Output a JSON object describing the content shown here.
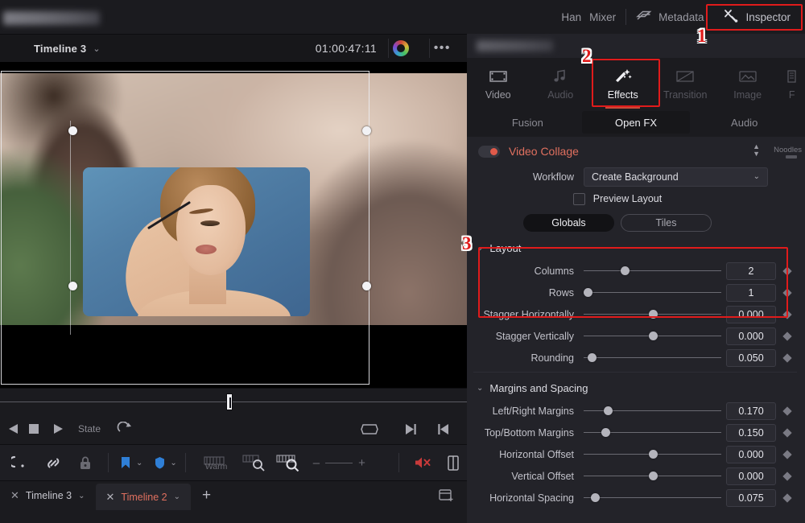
{
  "top_bar": {
    "items": [
      {
        "label": "Han",
        "icon": "",
        "dim": true
      },
      {
        "label": "Mixer",
        "icon": "mixer-icon",
        "dim": true
      },
      {
        "label": "Metadata",
        "icon": "metadata-tag-icon",
        "dim": true
      },
      {
        "label": "Inspector",
        "icon": "inspector-wrench-icon",
        "dim": false
      }
    ]
  },
  "timeline_header": {
    "name": "Timeline 3",
    "caret": "⌄",
    "timecode": "01:00:47:11",
    "dots": "•••"
  },
  "transport": {
    "state_label": "State",
    "buttons": [
      "reverse-play",
      "stop",
      "play",
      "loop",
      "fit-screen",
      "next-frame",
      "prev-frame"
    ]
  },
  "edit_toolbar": {
    "warm_label": "Warm",
    "zoom_minus": "–",
    "zoom_plus": "+"
  },
  "timeline_tabs": {
    "tabs": [
      {
        "label": "Timeline 3",
        "active": false
      },
      {
        "label": "Timeline 2",
        "active": true
      }
    ],
    "add_label": "+"
  },
  "inspector": {
    "tabs": [
      {
        "label": "Video",
        "icon": "video-clip-icon",
        "state": "normal"
      },
      {
        "label": "Audio",
        "icon": "audio-note-icon",
        "state": "disabled"
      },
      {
        "label": "Effects",
        "icon": "magic-wand-icon",
        "state": "active"
      },
      {
        "label": "Transition",
        "icon": "transition-icon",
        "state": "disabled"
      },
      {
        "label": "Image",
        "icon": "image-icon",
        "state": "disabled"
      },
      {
        "label": "F",
        "icon": "file-icon",
        "state": "disabled"
      }
    ],
    "segments": [
      {
        "label": "Fusion",
        "active": false
      },
      {
        "label": "Open FX",
        "active": true
      },
      {
        "label": "Audio",
        "active": false
      }
    ],
    "effect": {
      "title": "Video Collage",
      "enabled": true,
      "noodles_label": "Noodles",
      "workflow_label": "Workflow",
      "workflow_value": "Create Background",
      "preview_layout_label": "Preview Layout",
      "preview_layout_checked": false,
      "mode_pills": [
        {
          "label": "Globals",
          "active": true
        },
        {
          "label": "Tiles",
          "active": false
        }
      ]
    },
    "sections": [
      {
        "title": "Layout",
        "expanded": true,
        "params": [
          {
            "label": "Columns",
            "value": "2",
            "knob_pct": 30
          },
          {
            "label": "Rows",
            "value": "1",
            "knob_pct": 0
          },
          {
            "label": "Stagger Horizontally",
            "value": "0.000",
            "knob_pct": 50
          },
          {
            "label": "Stagger Vertically",
            "value": "0.000",
            "knob_pct": 50
          },
          {
            "label": "Rounding",
            "value": "0.050",
            "knob_pct": 4
          }
        ]
      },
      {
        "title": "Margins and Spacing",
        "expanded": true,
        "params": [
          {
            "label": "Left/Right Margins",
            "value": "0.170",
            "knob_pct": 17
          },
          {
            "label": "Top/Bottom Margins",
            "value": "0.150",
            "knob_pct": 15
          },
          {
            "label": "Horizontal Offset",
            "value": "0.000",
            "knob_pct": 50
          },
          {
            "label": "Vertical Offset",
            "value": "0.000",
            "knob_pct": 50
          },
          {
            "label": "Horizontal Spacing",
            "value": "0.075",
            "knob_pct": 7
          }
        ]
      }
    ]
  },
  "annotations": [
    {
      "number": "1",
      "target": "inspector-button"
    },
    {
      "number": "2",
      "target": "effects-tab"
    },
    {
      "number": "3",
      "target": "layout-section"
    }
  ],
  "colors": {
    "accent_red": "#e01b1b",
    "effect_title": "#e0705f",
    "active_tab_underline": "#c84a3a",
    "panel_bg": "#232329",
    "dark_bg": "#1b1b1f",
    "marker_blue": "#2f7fd6",
    "mute_red": "#c83a3a"
  }
}
